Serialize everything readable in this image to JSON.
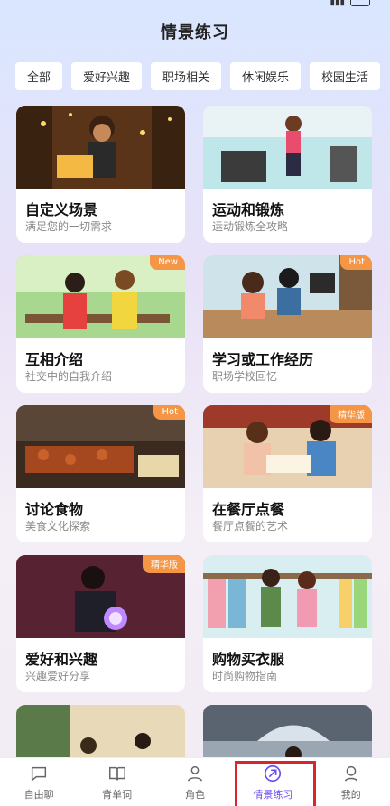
{
  "page": {
    "title": "情景练习"
  },
  "tabs": [
    "全部",
    "爱好兴趣",
    "职场相关",
    "休闲娱乐",
    "校园生活"
  ],
  "cards": [
    {
      "title": "自定义场景",
      "subtitle": "满足您的一切需求",
      "badge": ""
    },
    {
      "title": "运动和锻炼",
      "subtitle": "运动锻炼全攻略",
      "badge": ""
    },
    {
      "title": "互相介绍",
      "subtitle": "社交中的自我介绍",
      "badge": "New"
    },
    {
      "title": "学习或工作经历",
      "subtitle": "职场学校回忆",
      "badge": "Hot"
    },
    {
      "title": "讨论食物",
      "subtitle": "美食文化探索",
      "badge": "Hot"
    },
    {
      "title": "在餐厅点餐",
      "subtitle": "餐厅点餐的艺术",
      "badge": "精华版"
    },
    {
      "title": "爱好和兴趣",
      "subtitle": "兴趣爱好分享",
      "badge": "精华版"
    },
    {
      "title": "购物买衣服",
      "subtitle": "时尚购物指南",
      "badge": ""
    }
  ],
  "bottom_nav": [
    {
      "label": "自由聊",
      "icon": "chat-icon"
    },
    {
      "label": "背单词",
      "icon": "book-icon"
    },
    {
      "label": "角色",
      "icon": "person-icon"
    },
    {
      "label": "情景练习",
      "icon": "practice-icon"
    },
    {
      "label": "我的",
      "icon": "profile-icon"
    }
  ],
  "colors": {
    "accent": "#6b4cf0",
    "badge": "#f49646",
    "highlight_box": "#d7262e"
  }
}
